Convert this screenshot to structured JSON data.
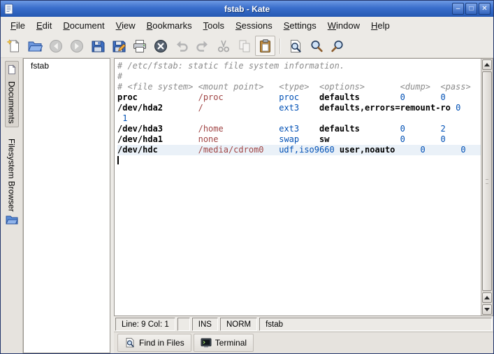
{
  "window": {
    "title": "fstab - Kate"
  },
  "palette": {
    "titlebar_blue": "#3A6ECB",
    "window_bg": "#ECEAE6",
    "editor_bg": "#FFFFFF",
    "current_line_highlight": "#EAF1F8",
    "comment_color": "#8C8C8C",
    "device_color": "#000000",
    "mount_point_color": "#A04545",
    "fs_type_color": "#0050B5",
    "number_color": "#0050B5"
  },
  "titlebar": {
    "app_icon": "kate-app-icon",
    "buttons": [
      {
        "name": "minimize-button",
        "glyph": "–"
      },
      {
        "name": "maximize-button",
        "glyph": "□"
      },
      {
        "name": "close-button",
        "glyph": "✕"
      }
    ]
  },
  "menubar": {
    "items": [
      "File",
      "Edit",
      "Document",
      "View",
      "Bookmarks",
      "Tools",
      "Sessions",
      "Settings",
      "Window",
      "Help"
    ]
  },
  "toolbar": {
    "buttons": [
      {
        "icon": "new-document-icon",
        "disabled": false
      },
      {
        "icon": "open-folder-icon",
        "disabled": false
      },
      {
        "icon": "back-icon",
        "disabled": true
      },
      {
        "icon": "forward-icon",
        "disabled": true
      },
      {
        "icon": "save-icon",
        "disabled": false
      },
      {
        "icon": "save-as-icon",
        "disabled": false
      },
      {
        "icon": "print-icon",
        "disabled": false
      },
      {
        "icon": "close-document-icon",
        "disabled": false
      },
      {
        "icon": "undo-icon",
        "disabled": true
      },
      {
        "icon": "redo-icon",
        "disabled": true
      },
      {
        "icon": "cut-icon",
        "disabled": true
      },
      {
        "icon": "copy-icon",
        "disabled": true
      },
      {
        "icon": "paste-icon",
        "disabled": false,
        "raised": true
      },
      {
        "icon": "separator"
      },
      {
        "icon": "find-icon",
        "disabled": false
      },
      {
        "icon": "find-next-icon",
        "disabled": false
      },
      {
        "icon": "find-previous-icon",
        "disabled": false
      }
    ]
  },
  "sidebar": {
    "tabs": [
      {
        "label": "Documents",
        "icon": "documents-icon",
        "active": true
      },
      {
        "label": "Filesystem Browser",
        "icon": "filesystem-folder-icon",
        "active": false
      }
    ]
  },
  "documents_panel": {
    "files": [
      "fstab"
    ]
  },
  "editor": {
    "lines": [
      {
        "tokens": [
          {
            "text": "# /etc/fstab: static file system information.",
            "cls": "c"
          }
        ]
      },
      {
        "tokens": [
          {
            "text": "#",
            "cls": "c"
          }
        ]
      },
      {
        "tokens": [
          {
            "text": "# <file system> <mount point>   <type>  <options>       <dump>  <pass>",
            "cls": "c"
          }
        ]
      },
      {
        "tokens": [
          {
            "text": "proc",
            "cls": "d"
          },
          {
            "text": "            ",
            "cls": "p"
          },
          {
            "text": "/proc",
            "cls": "m"
          },
          {
            "text": "           ",
            "cls": "p"
          },
          {
            "text": "proc",
            "cls": "t"
          },
          {
            "text": "    ",
            "cls": "p"
          },
          {
            "text": "defaults",
            "cls": "o"
          },
          {
            "text": "        ",
            "cls": "p"
          },
          {
            "text": "0",
            "cls": "n"
          },
          {
            "text": "       ",
            "cls": "p"
          },
          {
            "text": "0",
            "cls": "n"
          }
        ]
      },
      {
        "tokens": [
          {
            "text": "/dev/hda2",
            "cls": "d"
          },
          {
            "text": "       ",
            "cls": "p"
          },
          {
            "text": "/",
            "cls": "m"
          },
          {
            "text": "               ",
            "cls": "p"
          },
          {
            "text": "ext3",
            "cls": "t"
          },
          {
            "text": "    ",
            "cls": "p"
          },
          {
            "text": "defaults,errors=remount-ro",
            "cls": "o"
          },
          {
            "text": " ",
            "cls": "p"
          },
          {
            "text": "0",
            "cls": "n"
          }
        ]
      },
      {
        "tokens": [
          {
            "text": " ",
            "cls": "p"
          },
          {
            "text": "1",
            "cls": "n"
          }
        ]
      },
      {
        "tokens": [
          {
            "text": "/dev/hda3",
            "cls": "d"
          },
          {
            "text": "       ",
            "cls": "p"
          },
          {
            "text": "/home",
            "cls": "m"
          },
          {
            "text": "           ",
            "cls": "p"
          },
          {
            "text": "ext3",
            "cls": "t"
          },
          {
            "text": "    ",
            "cls": "p"
          },
          {
            "text": "defaults",
            "cls": "o"
          },
          {
            "text": "        ",
            "cls": "p"
          },
          {
            "text": "0",
            "cls": "n"
          },
          {
            "text": "       ",
            "cls": "p"
          },
          {
            "text": "2",
            "cls": "n"
          }
        ]
      },
      {
        "tokens": [
          {
            "text": "/dev/hda1",
            "cls": "d"
          },
          {
            "text": "       ",
            "cls": "p"
          },
          {
            "text": "none",
            "cls": "m"
          },
          {
            "text": "            ",
            "cls": "p"
          },
          {
            "text": "swap",
            "cls": "t"
          },
          {
            "text": "    ",
            "cls": "p"
          },
          {
            "text": "sw",
            "cls": "o"
          },
          {
            "text": "              ",
            "cls": "p"
          },
          {
            "text": "0",
            "cls": "n"
          },
          {
            "text": "       ",
            "cls": "p"
          },
          {
            "text": "0",
            "cls": "n"
          }
        ]
      },
      {
        "highlight": true,
        "tokens": [
          {
            "text": "/dev/hdc",
            "cls": "d"
          },
          {
            "text": "        ",
            "cls": "p"
          },
          {
            "text": "/media/cdrom0",
            "cls": "m"
          },
          {
            "text": "   ",
            "cls": "p"
          },
          {
            "text": "udf,iso9660",
            "cls": "t"
          },
          {
            "text": " ",
            "cls": "p"
          },
          {
            "text": "user,noauto",
            "cls": "o"
          },
          {
            "text": "     ",
            "cls": "p"
          },
          {
            "text": "0",
            "cls": "n"
          },
          {
            "text": "       ",
            "cls": "p"
          },
          {
            "text": "0",
            "cls": "n"
          }
        ]
      },
      {
        "cursor": true,
        "tokens": []
      }
    ]
  },
  "statusbar": {
    "line_col": "Line: 9 Col: 1",
    "modified_flag": "",
    "insert_mode": "INS",
    "selection_mode": "NORM",
    "filename": "fstab"
  },
  "tool_tabs": [
    {
      "label": "Find in Files",
      "icon": "find-in-files-icon"
    },
    {
      "label": "Terminal",
      "icon": "terminal-icon"
    }
  ]
}
